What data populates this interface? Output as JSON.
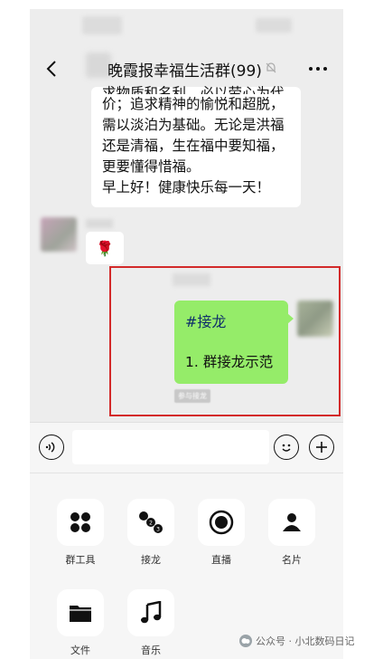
{
  "header": {
    "title": "晚霞报幸福生活群(99)"
  },
  "messages": {
    "text_lines": [
      "求物质和名利，必以劳心为代",
      "价；追求精神的愉悦和超脱，",
      "需以淡泊为基础。无论是洪福",
      "还是清福，生在福中要知福，",
      "更要懂得惜福。",
      "早上好！健康快乐每一天！"
    ],
    "sticker": "🌹",
    "jielong_tag": "#接龙",
    "jielong_item": "1. 群接龙示范",
    "join_label": "参与接龙"
  },
  "panel": {
    "tools": [
      {
        "label": "群工具",
        "icon": "four-dots-icon"
      },
      {
        "label": "接龙",
        "icon": "jielong-icon"
      },
      {
        "label": "直播",
        "icon": "live-icon"
      },
      {
        "label": "名片",
        "icon": "contact-card-icon"
      },
      {
        "label": "文件",
        "icon": "folder-icon"
      },
      {
        "label": "音乐",
        "icon": "music-icon"
      }
    ]
  },
  "watermark": {
    "text": "公众号 · 小北数码日记"
  },
  "colors": {
    "chat_bg": "#ededed",
    "self_bubble": "#95ec69",
    "highlight_border": "#d32a2a"
  }
}
